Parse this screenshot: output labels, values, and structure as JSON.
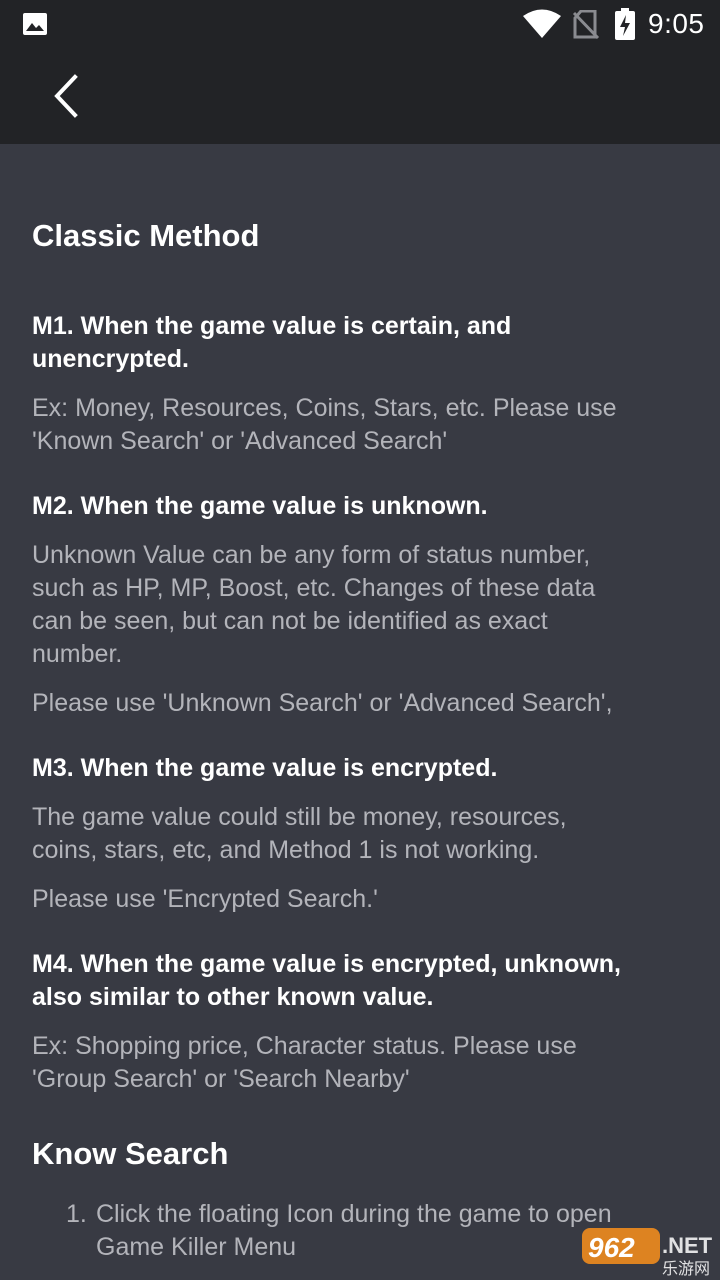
{
  "status_bar": {
    "time": "9:05",
    "icons": [
      "gallery-icon",
      "wifi-icon",
      "no-sim-icon",
      "battery-charging-icon"
    ]
  },
  "app_bar": {
    "back_icon": "chevron-left-icon"
  },
  "content": {
    "classic_title": "Classic Method",
    "m1": {
      "title_line1": "M1. When the game value is certain, and",
      "title_line2": "unencrypted.",
      "desc_line1": "Ex: Money, Resources, Coins, Stars, etc. Please use",
      "desc_line2": "'Known Search' or 'Advanced Search'"
    },
    "m2": {
      "title": "M2. When the game value is unknown.",
      "desc_line1": "Unknown Value can be any form of status number,",
      "desc_line2": "such as HP, MP, Boost, etc. Changes of these data",
      "desc_line3": "can be seen, but can not be identified as exact",
      "desc_line4": "number.",
      "usage": "Please use 'Unknown Search' or 'Advanced Search',"
    },
    "m3": {
      "title": "M3. When the game value is encrypted.",
      "desc_line1": "The game value could still be money, resources,",
      "desc_line2": "coins, stars, etc, and Method 1 is not working.",
      "usage": "Please use 'Encrypted Search.'"
    },
    "m4": {
      "title_line1": "M4. When the game value is encrypted, unknown,",
      "title_line2": "also similar to other known value.",
      "desc_line1": "Ex: Shopping price, Character status. Please use",
      "desc_line2": "'Group Search' or 'Search Nearby'"
    },
    "know_title": "Know Search",
    "steps": [
      {
        "number": "1.",
        "line1": "Click the floating Icon during the game to open",
        "line2": "Game Killer Menu"
      }
    ]
  },
  "watermark": {
    "digits": "962",
    "suffix": ".NET",
    "cn_text": "乐游网"
  },
  "colors": {
    "background": "#383a43",
    "bars": "#222326",
    "heading": "#ffffff",
    "body": "#b3b4ba",
    "watermark_orange": "#f08c1e"
  }
}
